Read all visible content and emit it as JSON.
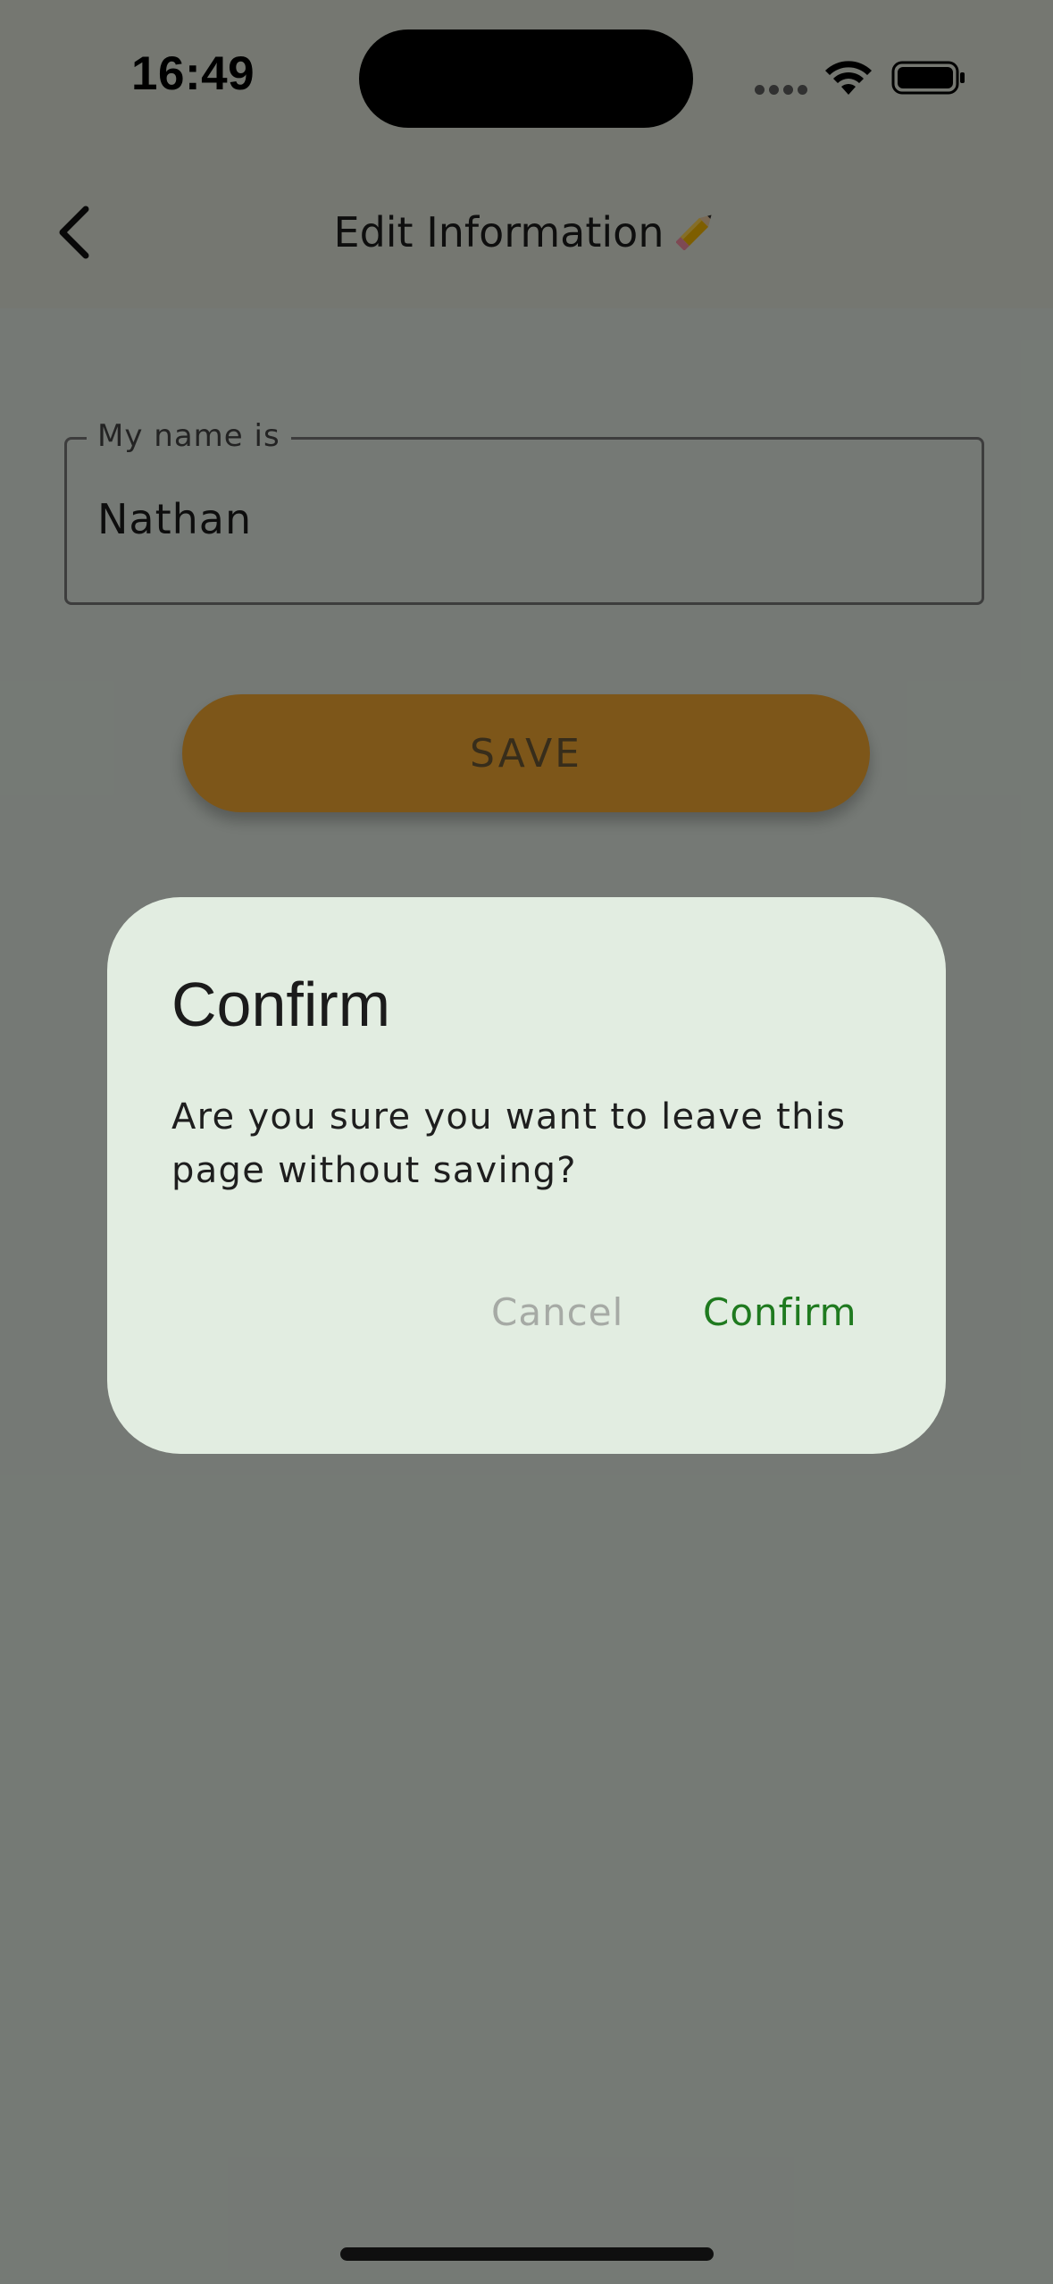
{
  "status_bar": {
    "time": "16:49",
    "icons": [
      "cellular-signal-icon",
      "wifi-icon",
      "battery-icon"
    ]
  },
  "app_bar": {
    "back_icon": "chevron-left-icon",
    "title": "Edit Information",
    "title_icon": "pencil-icon"
  },
  "form": {
    "name_label": "My name is",
    "name_value": "Nathan",
    "save_label": "SAVE"
  },
  "dialog": {
    "title": "Confirm",
    "message": "Are you sure you want to leave this page without saving?",
    "cancel_label": "Cancel",
    "confirm_label": "Confirm"
  },
  "colors": {
    "accent": "#F0A531",
    "dialog_background": "#E2EDE1",
    "confirm_text": "#1F7A1F",
    "cancel_text": "#A6AAA5",
    "scrim": "rgba(0,0,0,0.48)"
  }
}
